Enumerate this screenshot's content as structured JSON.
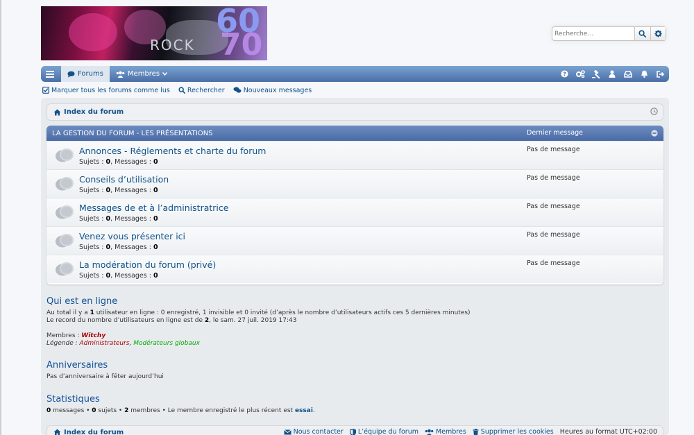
{
  "header": {
    "logo_text": "ROCK",
    "logo_num_top": "60",
    "logo_num_bottom": "70",
    "search_placeholder": "Recherche…"
  },
  "nav": {
    "forums": "Forums",
    "members": "Membres"
  },
  "sublinks": {
    "mark_read": "Marquer tous les forums comme lus",
    "search": "Rechercher",
    "new_posts": "Nouveaux messages"
  },
  "breadcrumb": {
    "index": "Index du forum"
  },
  "category": {
    "title": "La gestion du forum - Les présentations",
    "last_post_header": "Dernier message",
    "forums": [
      {
        "name": "Annonces - Réglements et charte du forum",
        "topics_label": "Sujets :",
        "topics": "0",
        "posts_label": "Messages :",
        "posts": "0",
        "last": "Pas de message"
      },
      {
        "name": "Conseils d’utilisation",
        "topics_label": "Sujets :",
        "topics": "0",
        "posts_label": "Messages :",
        "posts": "0",
        "last": "Pas de message"
      },
      {
        "name": "Messages de et à l’administratrice",
        "topics_label": "Sujets :",
        "topics": "0",
        "posts_label": "Messages :",
        "posts": "0",
        "last": "Pas de message"
      },
      {
        "name": "Venez vous présenter ici",
        "topics_label": "Sujets :",
        "topics": "0",
        "posts_label": "Messages :",
        "posts": "0",
        "last": "Pas de message"
      },
      {
        "name": "La modération du forum (privé)",
        "topics_label": "Sujets :",
        "topics": "0",
        "posts_label": "Messages :",
        "posts": "0",
        "last": "Pas de message"
      }
    ]
  },
  "online": {
    "title": "Qui est en ligne",
    "line1_a": "Au total il y a ",
    "line1_count": "1",
    "line1_b": " utilisateur en ligne : 0 enregistré, 1 invisible et 0 invité (d’après le nombre d’utilisateurs actifs ces 5 dernières minutes)",
    "line2_a": "Le record du nombre d’utilisateurs en ligne est de ",
    "line2_count": "2",
    "line2_b": ", le sam. 27 juil. 2019 17:43",
    "members_label": "Membres : ",
    "member": "Witchy",
    "legend_label": "Légende : ",
    "legend_admin": "Administrateurs",
    "legend_sep": ", ",
    "legend_mod": "Modérateurs globaux"
  },
  "birthdays": {
    "title": "Anniversaires",
    "text": "Pas d’anniversaire à fêter aujourd’hui"
  },
  "stats": {
    "title": "Statistiques",
    "messages_count": "0",
    "messages_label": " messages • ",
    "topics_count": "0",
    "topics_label": " sujets • ",
    "members_count": "2",
    "members_label": " membres • Le membre enregistré le plus récent est ",
    "newest": "essai",
    "end": "."
  },
  "footer": {
    "index": "Index du forum",
    "contact": "Nous contacter",
    "team": "L’équipe du forum",
    "members": "Membres",
    "cookies": "Supprimer les cookies",
    "timezone": "Heures au format UTC+02:00"
  },
  "colors": {
    "link": "#105289",
    "admin": "#AA0000",
    "mod": "#00AA00",
    "nav_top": "#7aa3d2",
    "nav_bottom": "#4a6ea6"
  }
}
